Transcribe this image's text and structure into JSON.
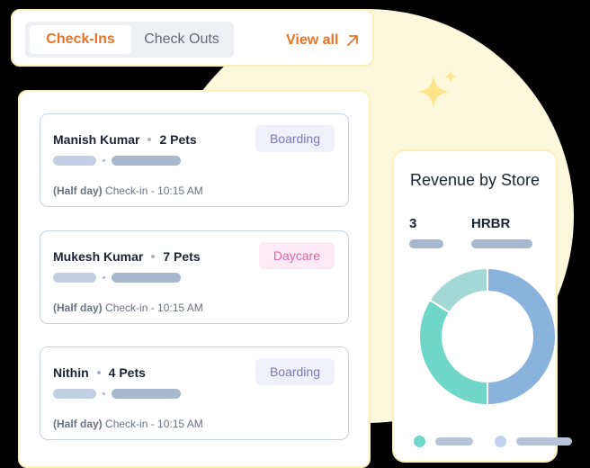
{
  "tabs": {
    "items": [
      {
        "label": "Check-Ins",
        "active": true
      },
      {
        "label": "Check Outs",
        "active": false
      }
    ],
    "view_all_label": "View all"
  },
  "checkins": [
    {
      "name": "Manish Kumar",
      "pets": "2 Pets",
      "tag": "Boarding",
      "tag_type": "boarding",
      "duration": "(Half day)",
      "time": "Check-in - 10:15 AM"
    },
    {
      "name": "Mukesh Kumar",
      "pets": "7 Pets",
      "tag": "Daycare",
      "tag_type": "daycare",
      "duration": "(Half day)",
      "time": "Check-in - 10:15 AM"
    },
    {
      "name": "Nithin",
      "pets": "4 Pets",
      "tag": "Boarding",
      "tag_type": "boarding",
      "duration": "(Half day)",
      "time": "Check-in - 10:15 AM"
    }
  ],
  "revenue": {
    "title": "Revenue by Store",
    "count": "3",
    "store": "HRBR"
  },
  "chart_data": {
    "type": "pie",
    "title": "Revenue by Store",
    "donut": true,
    "values": [
      50,
      34,
      16
    ],
    "colors": [
      "#89b2dd",
      "#70d6c8",
      "#a3d8d6"
    ],
    "legend": [
      {
        "color": "#70d6c8"
      },
      {
        "color": "#c2d2ee"
      }
    ]
  },
  "colors": {
    "accent": "#e8742a",
    "card_border": "#fbf1b8",
    "background_circle": "#fdf8dc",
    "sparkle": "#fde68a"
  },
  "icons": {
    "view_all": "arrow-up-right-icon",
    "decoration": "sparkle-icon"
  }
}
